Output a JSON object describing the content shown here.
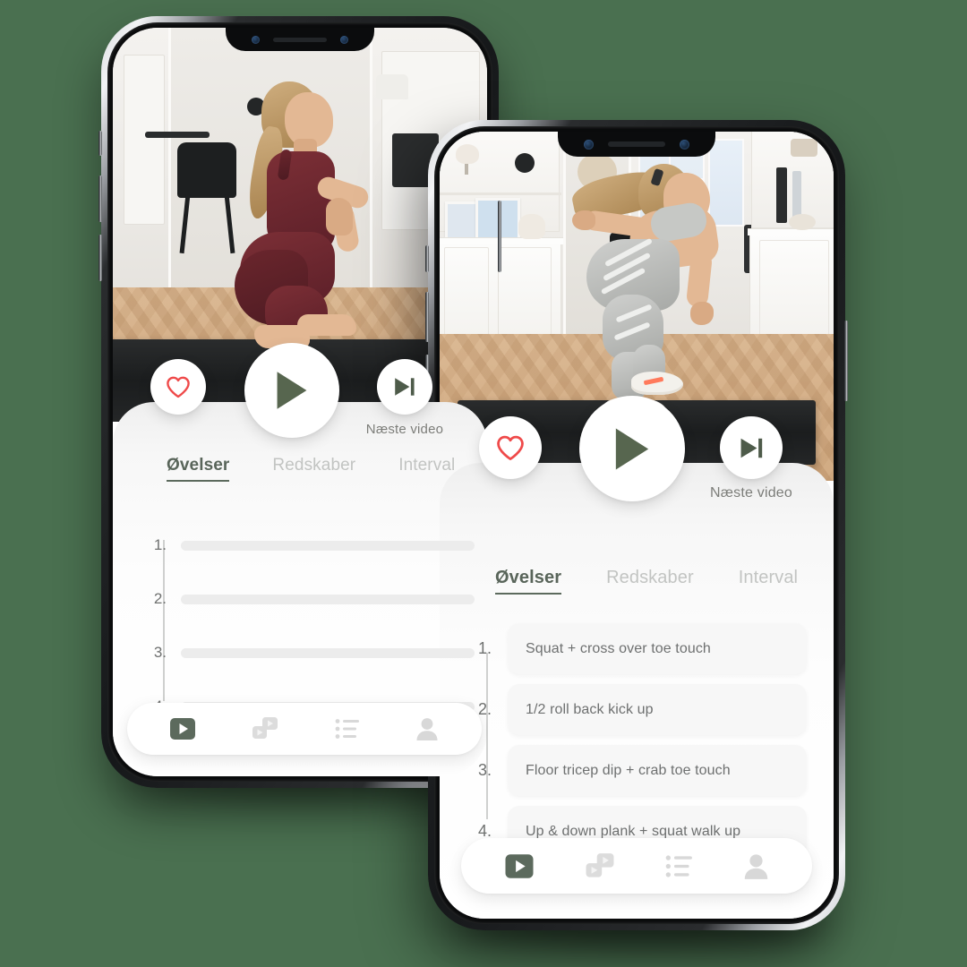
{
  "app": {
    "background_color": "#4a7050",
    "accent_color": "#5c6a5d",
    "heart_color": "#ef4a4a",
    "muted_text_color": "#6e7070"
  },
  "front_phone": {
    "controls": {
      "like_icon": "heart-outline-icon",
      "play_icon": "play-icon",
      "next_icon": "skip-forward-icon",
      "next_label": "Næste video"
    },
    "tabs": [
      {
        "label": "Øvelser",
        "active": true
      },
      {
        "label": "Redskaber",
        "active": false
      },
      {
        "label": "Interval",
        "active": false
      }
    ],
    "exercises": [
      {
        "number": "1.",
        "title": "Squat + cross over toe touch"
      },
      {
        "number": "2.",
        "title": "1/2 roll back kick up"
      },
      {
        "number": "3.",
        "title": "Floor tricep dip + crab toe touch"
      },
      {
        "number": "4.",
        "title": "Up & down plank  + squat walk up"
      }
    ],
    "nav": [
      {
        "icon": "video-play-icon",
        "active": true
      },
      {
        "icon": "equipment-icon",
        "active": false
      },
      {
        "icon": "list-icon",
        "active": false
      },
      {
        "icon": "profile-icon",
        "active": false
      }
    ],
    "video": {
      "scene": "woman-bent-over-squat-on-black-mat-in-living-room",
      "outfit_color": "#b8bab7",
      "shoe_accent_color": "#ff7a5c"
    }
  },
  "back_phone": {
    "controls": {
      "like_icon": "heart-outline-icon",
      "play_icon": "play-icon",
      "next_icon": "skip-forward-icon",
      "next_label": "Næste video"
    },
    "tabs": [
      {
        "label": "Øvelser",
        "active": true
      },
      {
        "label": "Redskaber",
        "active": false
      },
      {
        "label": "Interval",
        "active": false
      }
    ],
    "exercises": [
      {
        "number": "1.",
        "title": ""
      },
      {
        "number": "2.",
        "title": ""
      },
      {
        "number": "3.",
        "title": ""
      },
      {
        "number": "4.",
        "title": ""
      }
    ],
    "nav": [
      {
        "icon": "video-play-icon",
        "active": true
      },
      {
        "icon": "equipment-icon",
        "active": false
      },
      {
        "icon": "list-icon",
        "active": false
      },
      {
        "icon": "profile-icon",
        "active": false
      }
    ],
    "video": {
      "scene": "woman-in-deep-squat-on-black-mat-in-living-room",
      "outfit_color": "#6b262d"
    }
  }
}
